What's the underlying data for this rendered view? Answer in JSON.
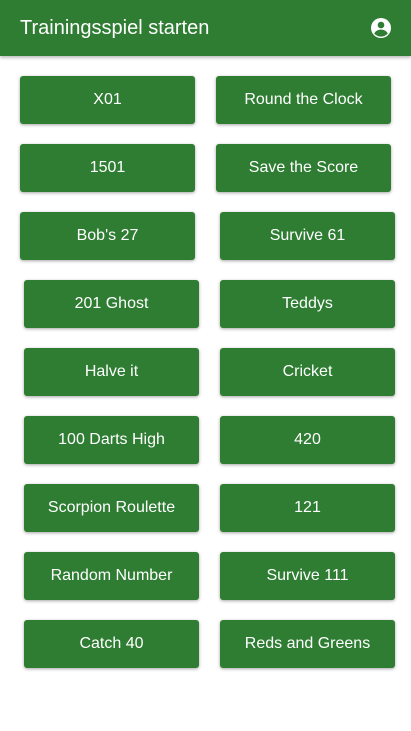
{
  "appbar": {
    "title": "Trainingsspiel starten",
    "account_icon": "account-circle-icon"
  },
  "colors": {
    "primary": "#2e7d32",
    "on_primary": "#ffffff",
    "background": "#ffffff"
  },
  "games": [
    {
      "label": "X01"
    },
    {
      "label": "Round the Clock"
    },
    {
      "label": "1501"
    },
    {
      "label": "Save the Score"
    },
    {
      "label": "Bob's 27"
    },
    {
      "label": "Survive 61"
    },
    {
      "label": "201 Ghost"
    },
    {
      "label": "Teddys"
    },
    {
      "label": "Halve it"
    },
    {
      "label": "Cricket"
    },
    {
      "label": "100 Darts High"
    },
    {
      "label": "420"
    },
    {
      "label": "Scorpion Roulette"
    },
    {
      "label": "121"
    },
    {
      "label": "Random Number"
    },
    {
      "label": "Survive 111"
    },
    {
      "label": "Catch 40"
    },
    {
      "label": "Reds and Greens"
    }
  ]
}
